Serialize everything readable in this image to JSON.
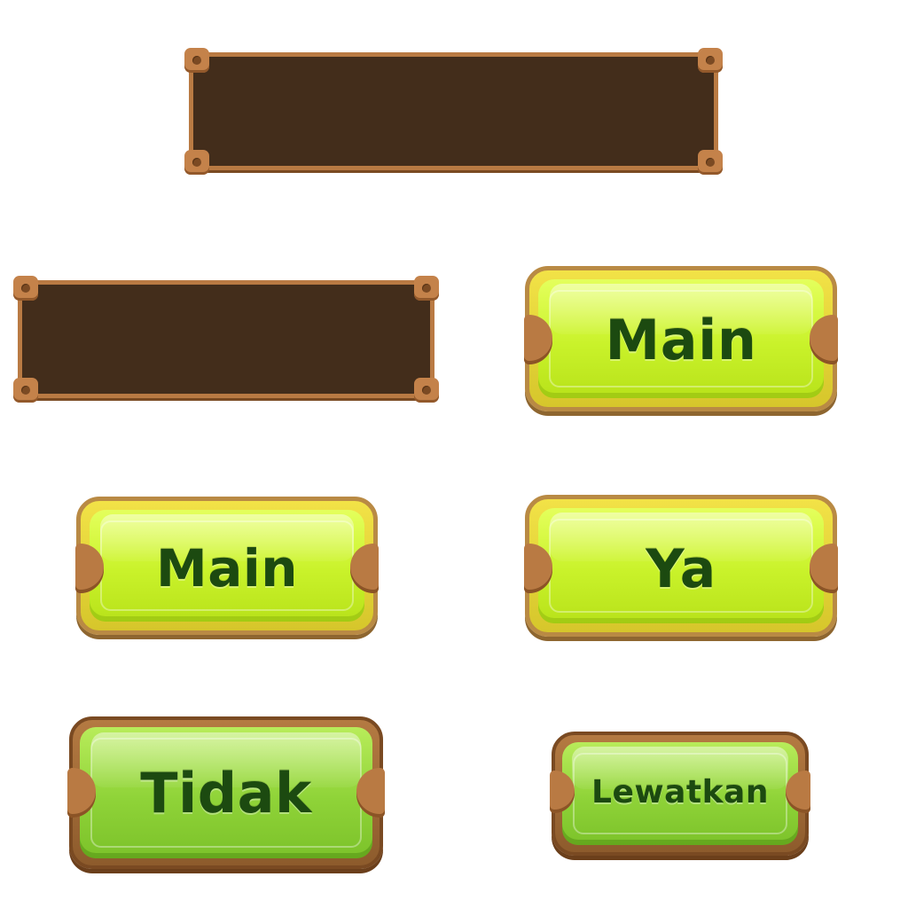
{
  "buttons": {
    "play_primary": {
      "label": "Main"
    },
    "play_secondary": {
      "label": "Main"
    },
    "yes": {
      "label": "Ya"
    },
    "no": {
      "label": "Tidak"
    },
    "skip": {
      "label": "Lewatkan"
    }
  },
  "colors": {
    "panel_fill": "#432d1b",
    "panel_frame": "#b97a43",
    "lime_face": "#c9f22a",
    "green_face": "#8fd338",
    "label_text": "#1c4a10"
  },
  "icons": [
    "bolt-icon",
    "side-tab-icon"
  ]
}
